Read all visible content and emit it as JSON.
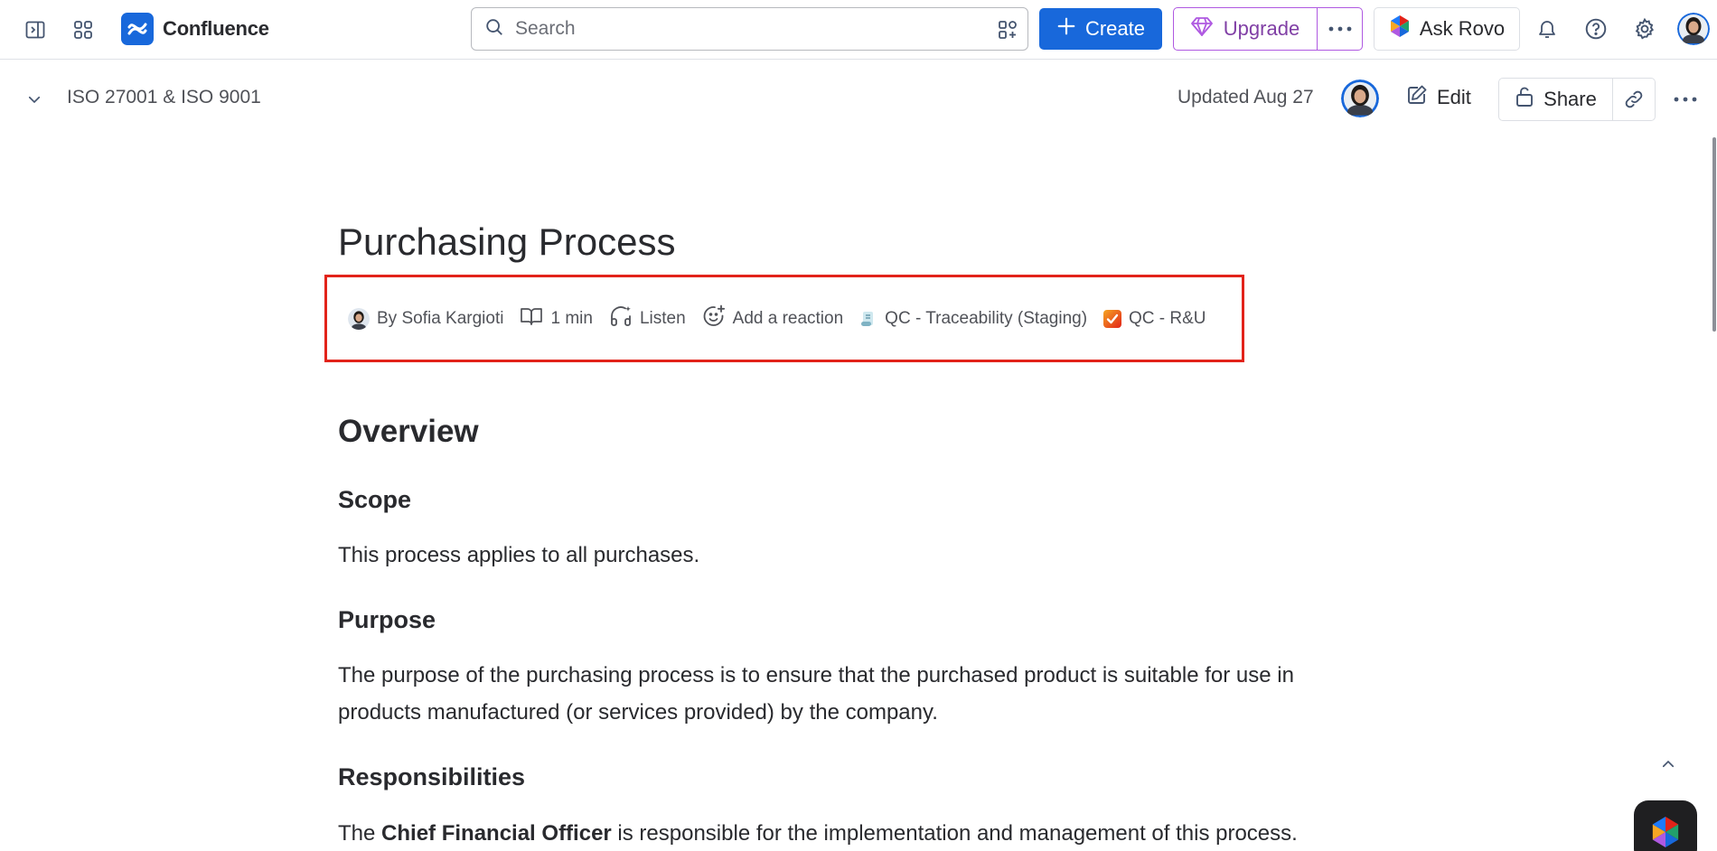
{
  "app": {
    "name": "Confluence"
  },
  "search": {
    "placeholder": "Search"
  },
  "topnav": {
    "create_label": "Create",
    "upgrade_label": "Upgrade",
    "rovo_label": "Ask Rovo",
    "icons": [
      "sidebar-toggle-icon",
      "app-switcher-icon",
      "search-icon",
      "filter-icon",
      "plus-icon",
      "gem-icon",
      "more-icon",
      "rovo-icon",
      "bell-icon",
      "help-icon",
      "gear-icon",
      "avatar"
    ]
  },
  "page_header": {
    "breadcrumb": "ISO 27001 & ISO 9001",
    "updated": "Updated Aug 27",
    "edit_label": "Edit",
    "share_label": "Share"
  },
  "page": {
    "title": "Purchasing Process",
    "byline": {
      "author": "By Sofia Kargioti",
      "read_time": "1 min",
      "listen": "Listen",
      "reaction": "Add a reaction",
      "tag1": "QC - Traceability (Staging)",
      "tag2": "QC - R&U"
    },
    "sections": {
      "overview": "Overview",
      "scope_heading": "Scope",
      "scope_text": "This process applies to all purchases.",
      "purpose_heading": "Purpose",
      "purpose_text": "The purpose of the purchasing process is to ensure that the purchased product is suitable for use in products manufactured (or services provided) by the company.",
      "responsibilities_heading": "Responsibilities",
      "resp_prefix": "The ",
      "resp_bold": "Chief Financial Officer",
      "resp_suffix": " is responsible for the implementation and management of this process."
    }
  },
  "colors": {
    "brand_blue": "#1868db",
    "upgrade_purple": "#803fa5",
    "highlight_red": "#e2231a",
    "text": "#292a2e",
    "subtle_text": "#505258"
  }
}
